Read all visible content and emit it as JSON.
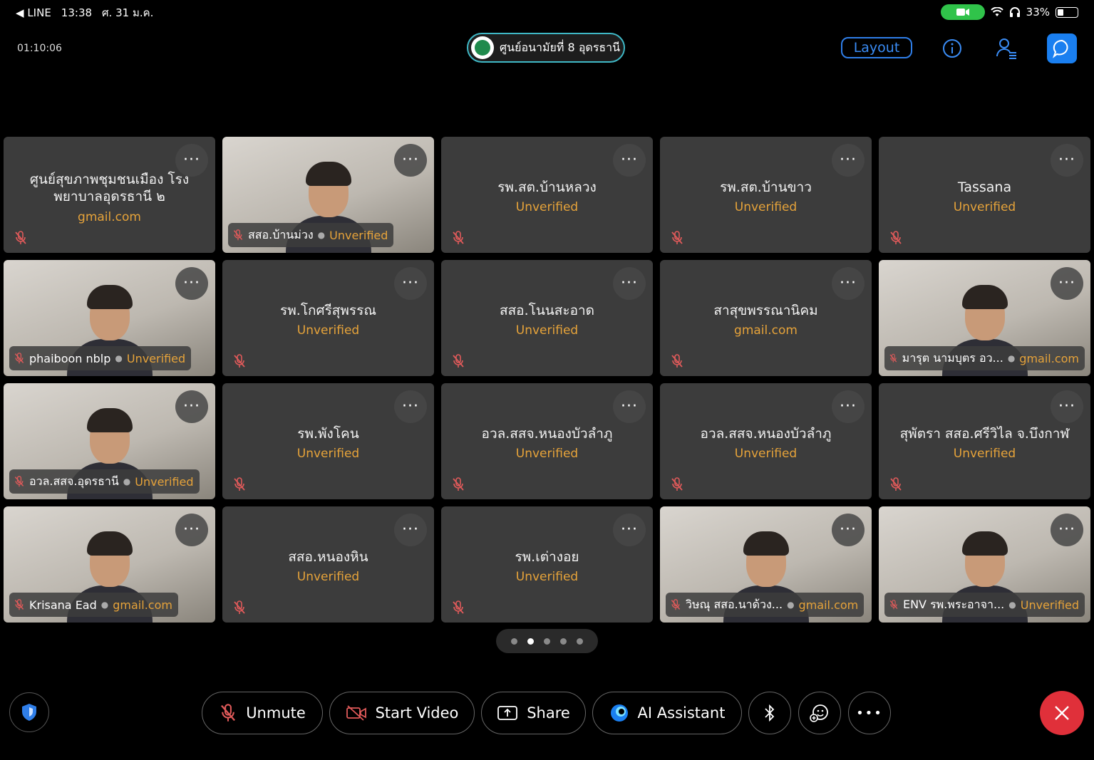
{
  "status_bar": {
    "back_app": "LINE",
    "time": "13:38",
    "date": "ศ. 31 ม.ค.",
    "battery": "33%"
  },
  "header": {
    "timer": "01:10:06",
    "meeting_title": "ศูนย์อนามัยที่ 8 อุดรธานี",
    "layout_label": "Layout"
  },
  "tiles": [
    {
      "name": "ศูนย์สุขภาพชุมชนเมือง โรงพยาบาลอุดรธานี ๒",
      "badge": "gmail.com",
      "video": false
    },
    {
      "name": "สสอ.บ้านม่วง",
      "badge": "Unverified",
      "video": true
    },
    {
      "name": "รพ.สต.บ้านหลวง",
      "badge": "Unverified",
      "video": false
    },
    {
      "name": "รพ.สต.บ้านขาว",
      "badge": "Unverified",
      "video": false
    },
    {
      "name": "Tassana",
      "badge": "Unverified",
      "video": false
    },
    {
      "name": "phaiboon nblp",
      "badge": "Unverified",
      "video": true
    },
    {
      "name": "รพ.โกศรีสุพรรณ",
      "badge": "Unverified",
      "video": false
    },
    {
      "name": "สสอ.โนนสะอาด",
      "badge": "Unverified",
      "video": false
    },
    {
      "name": "สาสุขพรรณานิคม",
      "badge": "gmail.com",
      "video": false
    },
    {
      "name": "มารุต นามบุตร อว...",
      "badge": "gmail.com",
      "video": true
    },
    {
      "name": "อวล.สสจ.อุดรธานี",
      "badge": "Unverified",
      "video": true
    },
    {
      "name": "รพ.พังโคน",
      "badge": "Unverified",
      "video": false
    },
    {
      "name": "อวล.สสจ.หนองบัวลำภู",
      "badge": "Unverified",
      "video": false
    },
    {
      "name": "อวล.สสจ.หนองบัวลำภู",
      "badge": "Unverified",
      "video": false
    },
    {
      "name": "สุพัตรา สสอ.ศรีวิไล จ.บึงกาฬ",
      "badge": "Unverified",
      "video": false
    },
    {
      "name": "Krisana Ead",
      "badge": "gmail.com",
      "video": true
    },
    {
      "name": "สสอ.หนองหิน",
      "badge": "Unverified",
      "video": false
    },
    {
      "name": "รพ.เต่างอย",
      "badge": "Unverified",
      "video": false
    },
    {
      "name": "วิษณุ สสอ.นาด้วง...",
      "badge": "gmail.com",
      "video": true
    },
    {
      "name": "ENV รพ.พระอาจา...",
      "badge": "Unverified",
      "video": true
    }
  ],
  "pager": {
    "pages": 5,
    "active_index": 1
  },
  "toolbar": {
    "unmute_label": "Unmute",
    "start_video_label": "Start Video",
    "share_label": "Share",
    "ai_assistant_label": "AI Assistant",
    "more_glyph": "•••"
  },
  "colors": {
    "accent_blue": "#1a7ff0",
    "badge_orange": "#e6a33a",
    "leave_red": "#e0303a",
    "tile_bg": "#3c3c3c"
  }
}
